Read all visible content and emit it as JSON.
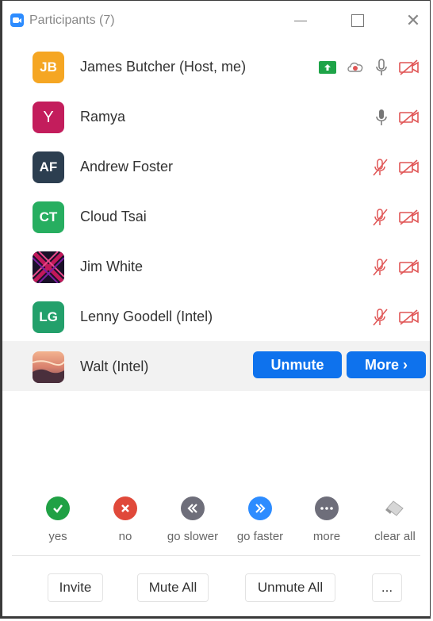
{
  "window": {
    "title": "Participants (7)"
  },
  "participants": [
    {
      "initials": "JB",
      "name": "James Butcher (Host, me)",
      "avatar_color": "#f5a623"
    },
    {
      "initials": "Y",
      "name": "Ramya",
      "avatar_color": "#c31d5c"
    },
    {
      "initials": "AF",
      "name": "Andrew Foster",
      "avatar_color": "#2c3e50"
    },
    {
      "initials": "CT",
      "name": "Cloud Tsai",
      "avatar_color": "#27ae60"
    },
    {
      "initials": "",
      "name": "Jim White",
      "avatar_color": "#1a1a2e"
    },
    {
      "initials": "LG",
      "name": "Lenny Goodell (Intel)",
      "avatar_color": "#23a06b"
    },
    {
      "initials": "",
      "name": "Walt (Intel)",
      "avatar_color": "#d9826e"
    }
  ],
  "row_actions": {
    "unmute": "Unmute",
    "more": "More ›"
  },
  "reactions": [
    {
      "label": "yes",
      "color": "#20a145",
      "icon": "check-icon"
    },
    {
      "label": "no",
      "color": "#e0493a",
      "icon": "x-icon"
    },
    {
      "label": "go slower",
      "color": "#6e6e7a",
      "icon": "rewind-icon"
    },
    {
      "label": "go faster",
      "color": "#2d8cff",
      "icon": "fast-forward-icon"
    },
    {
      "label": "more",
      "color": "#6e6e7a",
      "icon": "more-dots-icon"
    },
    {
      "label": "clear all",
      "color": "#888888",
      "icon": "eraser-icon"
    }
  ],
  "footer": {
    "invite": "Invite",
    "mute_all": "Mute All",
    "unmute_all": "Unmute All",
    "more": "..."
  },
  "colors": {
    "accent": "#0e72ed",
    "muted_red": "#e05555",
    "share_green": "#1ea448"
  }
}
